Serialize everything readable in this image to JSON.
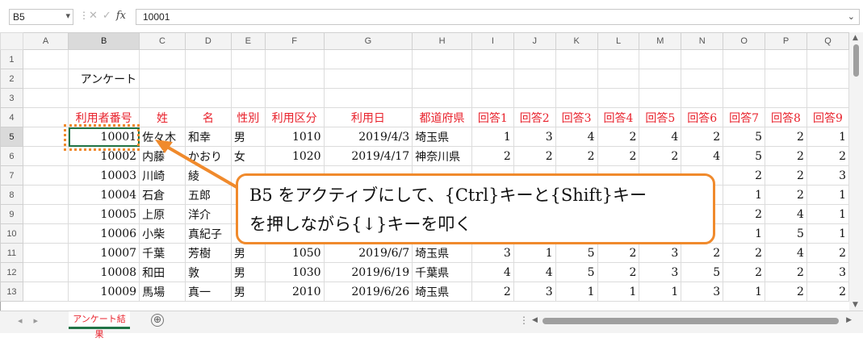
{
  "formula_bar": {
    "name_box": "B5",
    "name_box_arrow": "▾",
    "separator": "⋮",
    "cancel_glyph": "✕",
    "enter_glyph": "✓",
    "fx": "fx",
    "value": "10001",
    "expand_glyph": "⌄"
  },
  "columns": [
    "A",
    "B",
    "C",
    "D",
    "E",
    "F",
    "G",
    "H",
    "I",
    "J",
    "K",
    "L",
    "M",
    "N",
    "O",
    "P",
    "Q"
  ],
  "rows": [
    {
      "n": "1",
      "cells": [
        "",
        "",
        "",
        "",
        "",
        "",
        "",
        "",
        "",
        "",
        "",
        "",
        "",
        "",
        "",
        "",
        ""
      ]
    },
    {
      "n": "2",
      "cells": [
        "",
        "アンケート",
        "",
        "",
        "",
        "",
        "",
        "",
        "",
        "",
        "",
        "",
        "",
        "",
        "",
        "",
        ""
      ]
    },
    {
      "n": "3",
      "cells": [
        "",
        "",
        "",
        "",
        "",
        "",
        "",
        "",
        "",
        "",
        "",
        "",
        "",
        "",
        "",
        "",
        ""
      ]
    },
    {
      "n": "4",
      "cells": [
        "",
        "利用者番号",
        "姓",
        "名",
        "性別",
        "利用区分",
        "利用日",
        "都道府県",
        "回答1",
        "回答2",
        "回答3",
        "回答4",
        "回答5",
        "回答6",
        "回答7",
        "回答8",
        "回答9"
      ]
    },
    {
      "n": "5",
      "cells": [
        "",
        "10001",
        "佐々木",
        "和幸",
        "男",
        "1010",
        "2019/4/3",
        "埼玉県",
        "1",
        "3",
        "4",
        "2",
        "4",
        "2",
        "5",
        "2",
        "1"
      ]
    },
    {
      "n": "6",
      "cells": [
        "",
        "10002",
        "内藤",
        "かおり",
        "女",
        "1020",
        "2019/4/17",
        "神奈川県",
        "2",
        "2",
        "2",
        "2",
        "2",
        "4",
        "5",
        "2",
        "2"
      ]
    },
    {
      "n": "7",
      "cells": [
        "",
        "10003",
        "川崎",
        "綾",
        "",
        "",
        "",
        "",
        "",
        "",
        "",
        "",
        "",
        "",
        "2",
        "2",
        "3"
      ]
    },
    {
      "n": "8",
      "cells": [
        "",
        "10004",
        "石倉",
        "五郎",
        "",
        "",
        "",
        "",
        "",
        "",
        "",
        "",
        "",
        "",
        "1",
        "2",
        "1"
      ]
    },
    {
      "n": "9",
      "cells": [
        "",
        "10005",
        "上原",
        "洋介",
        "",
        "",
        "",
        "",
        "",
        "",
        "",
        "",
        "",
        "",
        "2",
        "4",
        "1"
      ]
    },
    {
      "n": "10",
      "cells": [
        "",
        "10006",
        "小柴",
        "真紀子",
        "",
        "",
        "",
        "",
        "",
        "",
        "",
        "",
        "",
        "",
        "1",
        "5",
        "1"
      ]
    },
    {
      "n": "11",
      "cells": [
        "",
        "10007",
        "千葉",
        "芳樹",
        "男",
        "1050",
        "2019/6/7",
        "埼玉県",
        "3",
        "1",
        "5",
        "2",
        "3",
        "2",
        "2",
        "4",
        "2"
      ]
    },
    {
      "n": "12",
      "cells": [
        "",
        "10008",
        "和田",
        "敦",
        "男",
        "1030",
        "2019/6/19",
        "千葉県",
        "4",
        "4",
        "5",
        "2",
        "3",
        "5",
        "2",
        "2",
        "3"
      ]
    },
    {
      "n": "13",
      "cells": [
        "",
        "10009",
        "馬場",
        "真一",
        "男",
        "2010",
        "2019/6/26",
        "埼玉県",
        "2",
        "3",
        "1",
        "1",
        "1",
        "3",
        "1",
        "2",
        "2"
      ]
    }
  ],
  "callout": {
    "line1": "B5 をアクティブにして、{Ctrl}キーと{Shift}キー",
    "line2": "を押しながら{↓}キーを叩く"
  },
  "sheet_tab": "アンケート結果",
  "add_sheet": "⊕",
  "colors": {
    "accent_orange": "#f08a2c",
    "header_red": "#e8222c",
    "active_green": "#217346"
  }
}
